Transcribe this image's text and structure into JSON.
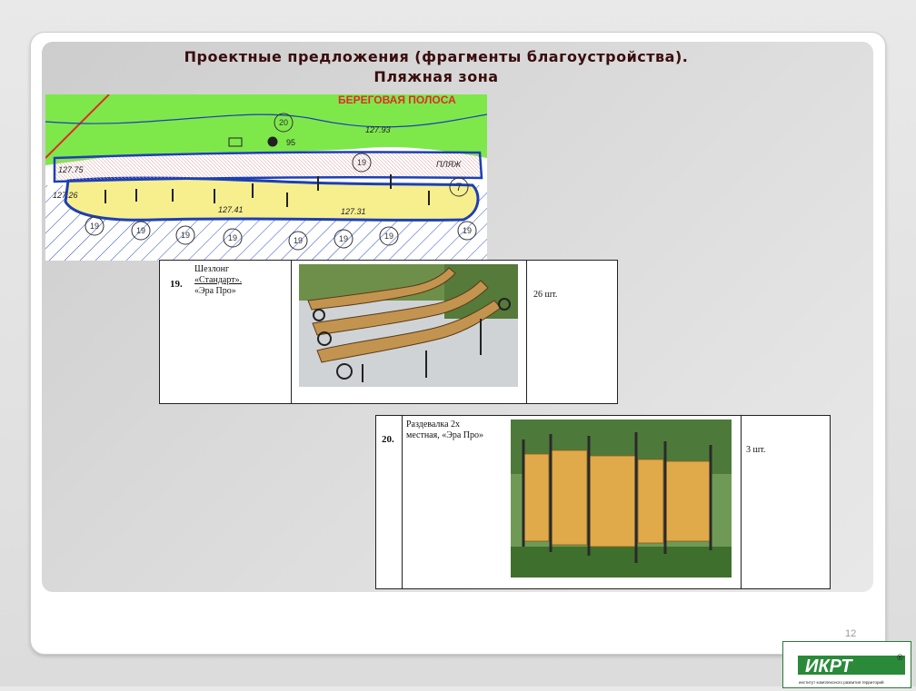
{
  "slide": {
    "title_line1": "Проектные предложения (фрагменты благоустройства).",
    "title_line2": "Пляжная зона",
    "page_number": "12"
  },
  "map": {
    "shore_label": "БЕРЕГОВАЯ ПОЛОСА",
    "beach_label": "ПЛЯЖ",
    "elevations": [
      "127.93",
      "127.75",
      "127.26",
      "127.41",
      "127.31",
      "95"
    ],
    "markers": [
      "20",
      "19",
      "7",
      "19",
      "19",
      "19",
      "19",
      "19",
      "19",
      "19",
      "19"
    ],
    "colors": {
      "green": "#7ee84a",
      "beach": "#f7ef8e",
      "blue": "#1d3fb5",
      "red": "#e02b2b"
    }
  },
  "items": [
    {
      "number": "19.",
      "name_line1": "Шезлонг",
      "name_line2": "«Стандарт».",
      "name_line3": "«Эра Про»",
      "quantity": "26 шт."
    },
    {
      "number": "20.",
      "name_line1": "Раздевалка 2х",
      "name_line2": "местная, «Эра Про»",
      "quantity": "3 шт."
    }
  ],
  "logo": {
    "text": "ИКРТ",
    "registered": "®",
    "caption": "институт комплексного развития территорий"
  }
}
